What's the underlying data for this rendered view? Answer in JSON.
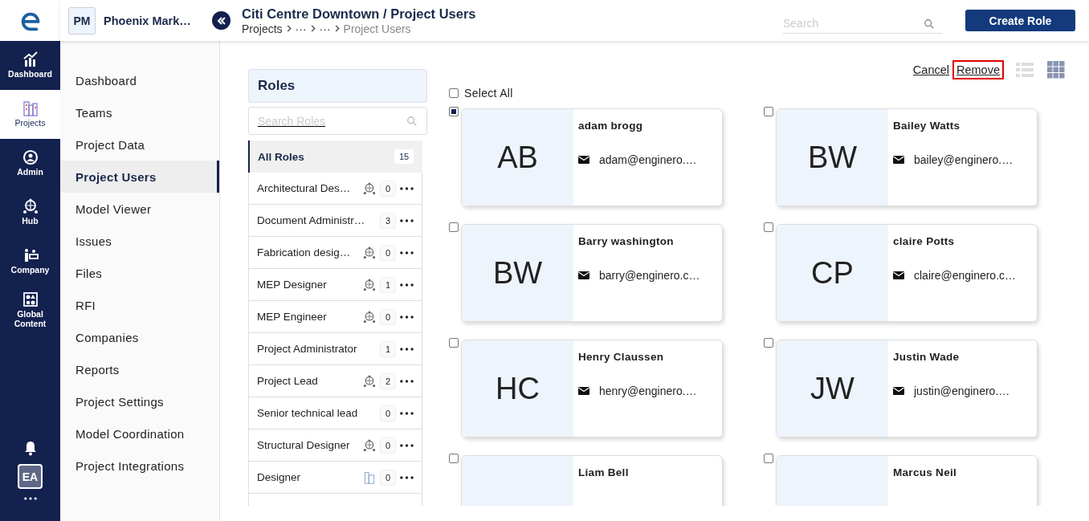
{
  "rail": {
    "items": [
      {
        "label": "Dashboard",
        "kind": "chart",
        "selected": false
      },
      {
        "label": "Projects",
        "kind": "buildings",
        "selected": true
      },
      {
        "label": "Admin",
        "kind": "admin",
        "selected": false
      },
      {
        "label": "Hub",
        "kind": "hub",
        "selected": false
      },
      {
        "label": "Company",
        "kind": "company",
        "selected": false
      },
      {
        "label": "Global Content",
        "kind": "shapes",
        "selected": false
      }
    ],
    "avatar": "EA"
  },
  "project": {
    "badge": "PM",
    "name": "Phoenix Mark…"
  },
  "header": {
    "title": "Citi Centre Downtown / Project Users",
    "breadcrumb": [
      "Projects",
      "···",
      "···",
      "Project Users"
    ],
    "search": {
      "placeholder": "Search"
    },
    "create_button": "Create Role"
  },
  "nav": {
    "items": [
      {
        "label": "Dashboard",
        "selected": false
      },
      {
        "label": "Teams",
        "selected": false
      },
      {
        "label": "Project Data",
        "selected": false
      },
      {
        "label": "Project Users",
        "selected": true
      },
      {
        "label": "Model Viewer",
        "selected": false
      },
      {
        "label": "Issues",
        "selected": false
      },
      {
        "label": "Files",
        "selected": false
      },
      {
        "label": "RFI",
        "selected": false
      },
      {
        "label": "Companies",
        "selected": false
      },
      {
        "label": "Reports",
        "selected": false
      },
      {
        "label": "Project Settings",
        "selected": false
      },
      {
        "label": "Model Coordination",
        "selected": false
      },
      {
        "label": "Project Integrations",
        "selected": false
      }
    ]
  },
  "roles": {
    "title": "Roles",
    "search": {
      "placeholder": "Search Roles"
    },
    "items": [
      {
        "name": "All Roles",
        "count": "15",
        "kind": "all",
        "selected": true
      },
      {
        "name": "Architectural Des…",
        "count": "0",
        "kind": "hub",
        "selected": false
      },
      {
        "name": "Document Administr…",
        "count": "3",
        "kind": "plain",
        "selected": false
      },
      {
        "name": "Fabrication desig…",
        "count": "0",
        "kind": "hub",
        "selected": false
      },
      {
        "name": "MEP Designer",
        "count": "1",
        "kind": "hub",
        "selected": false
      },
      {
        "name": "MEP Engineer",
        "count": "0",
        "kind": "hub",
        "selected": false
      },
      {
        "name": "Project Administrator",
        "count": "1",
        "kind": "plain",
        "selected": false
      },
      {
        "name": "Project Lead",
        "count": "2",
        "kind": "hub",
        "selected": false
      },
      {
        "name": "Senior technical lead",
        "count": "0",
        "kind": "plain",
        "selected": false
      },
      {
        "name": "Structural Designer",
        "count": "0",
        "kind": "hub",
        "selected": false
      },
      {
        "name": "Designer",
        "count": "0",
        "kind": "building",
        "selected": false
      }
    ]
  },
  "toolbar": {
    "cancel": "Cancel",
    "remove": {
      "label": "Remove",
      "focused": true
    },
    "views": [
      {
        "kind": "list",
        "selected": false
      },
      {
        "kind": "grid",
        "selected": true
      }
    ]
  },
  "select_all": {
    "label": "Select All",
    "checked": false
  },
  "users": [
    {
      "initials": "AB",
      "name": "adam brogg",
      "email": "adam@enginero.…",
      "checked": true
    },
    {
      "initials": "BW",
      "name": "Bailey Watts",
      "email": "bailey@enginero.…",
      "checked": false
    },
    {
      "initials": "BW",
      "name": "Barry washington",
      "email": "barry@enginero.c…",
      "checked": false
    },
    {
      "initials": "CP",
      "name": "claire Potts",
      "email": "claire@enginero.c…",
      "checked": false
    },
    {
      "initials": "HC",
      "name": "Henry Claussen",
      "email": "henry@enginero.…",
      "checked": false
    },
    {
      "initials": "JW",
      "name": "Justin Wade",
      "email": "justin@enginero.…",
      "checked": false
    },
    {
      "name": "Liam Bell",
      "checked": false
    },
    {
      "name": "Marcus Neil",
      "checked": false
    }
  ]
}
